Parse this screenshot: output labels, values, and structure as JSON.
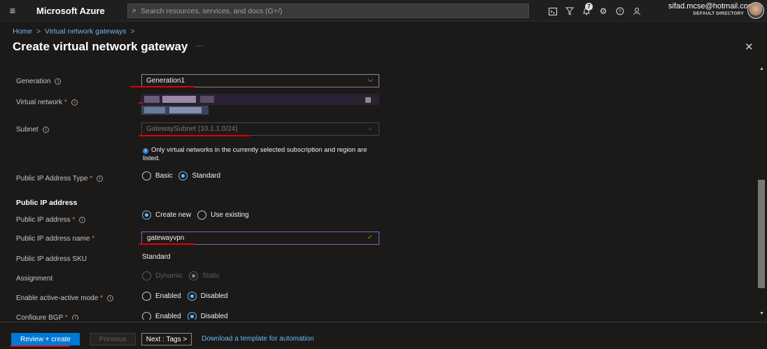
{
  "topbar": {
    "menu_icon": "hamburger-icon",
    "brand": "Microsoft Azure",
    "search_placeholder": "Search resources, services, and docs (G+/)",
    "icons": [
      "cloud-shell-icon",
      "directory-filter-icon",
      "notifications-icon",
      "settings-icon",
      "help-icon",
      "feedback-icon"
    ],
    "notification_count": "7",
    "account_email": "sifad.mcse@hotmail.com",
    "account_directory": "DEFAULT DIRECTORY"
  },
  "breadcrumb": {
    "home": "Home",
    "parent": "Virtual network gateways",
    "sep": ">"
  },
  "page": {
    "title": "Create virtual network gateway",
    "more": "···",
    "close": "✕"
  },
  "form": {
    "generation": {
      "label": "Generation",
      "value": "Generation1"
    },
    "virtual_network": {
      "label": "Virtual network",
      "required": "*"
    },
    "subnet": {
      "label": "Subnet",
      "value": "GatewaySubnet (10.1.1.0/24)"
    },
    "subnet_note": "Only virtual networks in the currently selected subscription and region are listed.",
    "public_ip_type": {
      "label": "Public IP Address Type",
      "required": "*",
      "options": [
        "Basic",
        "Standard"
      ],
      "selected": "Standard"
    },
    "public_ip_section": "Public IP address",
    "public_ip_address": {
      "label": "Public IP address",
      "required": "*",
      "options": [
        "Create new",
        "Use existing"
      ],
      "selected": "Create new"
    },
    "public_ip_name": {
      "label": "Public IP address name",
      "required": "*",
      "value": "gatewayvpn"
    },
    "public_ip_sku": {
      "label": "Public IP address SKU",
      "value": "Standard"
    },
    "assignment": {
      "label": "Assignment",
      "options": [
        "Dynamic",
        "Static"
      ],
      "selected": "Static"
    },
    "active_active": {
      "label": "Enable active-active mode",
      "required": "*",
      "options": [
        "Enabled",
        "Disabled"
      ],
      "selected": "Disabled"
    },
    "configure_bgp": {
      "label": "Configure BGP",
      "required": "*",
      "options": [
        "Enabled",
        "Disabled"
      ],
      "selected": "Disabled"
    }
  },
  "footer": {
    "review_create": "Review + create",
    "previous": "Previous",
    "next": "Next : Tags >",
    "download_link": "Download a template for automation"
  },
  "colors": {
    "accent": "#0078d4",
    "link": "#6cb8f6",
    "annotation_red": "#e00000",
    "required": "#f1707b"
  }
}
